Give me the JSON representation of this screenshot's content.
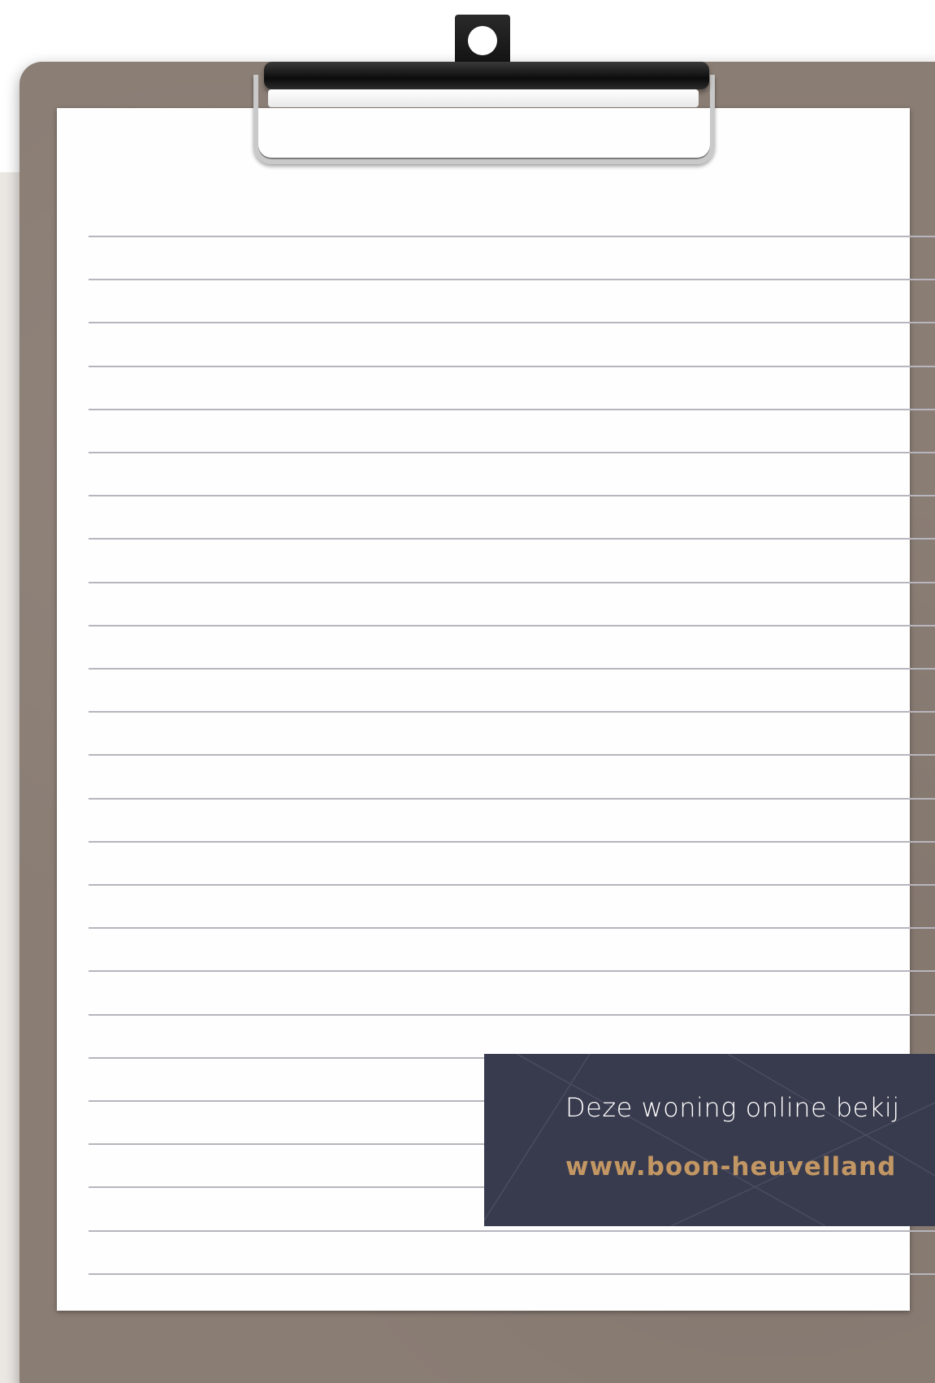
{
  "colors": {
    "board": "#8a7d74",
    "paper": "#fefefe",
    "rule_line": "#b7b5bd",
    "banner_background": "#383a4d",
    "banner_text": "#ffffff",
    "banner_link": "#c39763",
    "backdrop": "#ebe7e3"
  },
  "notes": {
    "line_count": 25
  },
  "banner": {
    "text": "Deze woning online bekij",
    "url": "www.boon-heuvelland"
  },
  "icons": {
    "clip": "clipboard-clip-icon"
  }
}
